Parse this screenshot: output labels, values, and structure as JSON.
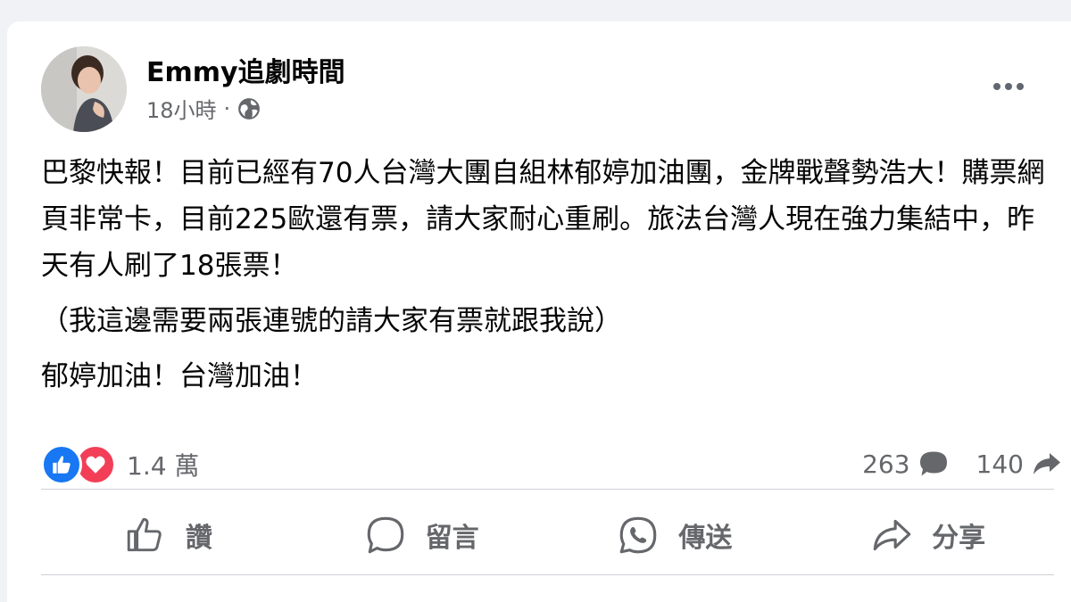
{
  "post": {
    "author": "Emmy追劇時間",
    "time": "18小時",
    "separator": "·",
    "visibility_icon": "globe-icon",
    "more_icon": "more-icon",
    "body": [
      "巴黎快報！目前已經有70人台灣大團自組林郁婷加油團，金牌戰聲勢浩大！購票網頁非常卡，目前225歐還有票，請大家耐心重刷。旅法台灣人現在強力集結中，昨天有人刷了18張票！",
      "（我這邊需要兩張連號的請大家有票就跟我說）",
      "郁婷加油！台灣加油！"
    ]
  },
  "stats": {
    "reactions_count": "1.4 萬",
    "comments_count": "263",
    "shares_count": "140"
  },
  "actions": {
    "like_label": "讚",
    "comment_label": "留言",
    "send_label": "傳送",
    "share_label": "分享"
  },
  "colors": {
    "like_blue": "#1877f2",
    "love_red": "#f33e58",
    "secondary_text": "#65676b"
  }
}
